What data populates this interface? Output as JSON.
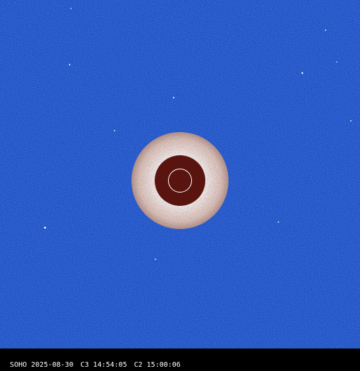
{
  "caption": {
    "source": "SOHO",
    "date": "2025-08-30",
    "c3": "C3 14:54:05",
    "c2": "C2 15:00:06"
  },
  "colors": {
    "sky": "#1f4fc2",
    "occulter": "#5a140f",
    "inner_halo": "#f2e6df",
    "caption_bg": "#000000",
    "caption_text": "#ffffff"
  }
}
